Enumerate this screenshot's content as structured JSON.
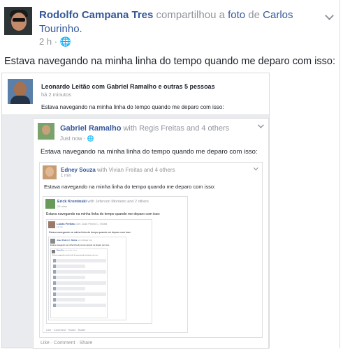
{
  "post": {
    "author": "Rodolfo Campana Tres",
    "action": "compartilhou a",
    "object": "foto",
    "preposition": "de",
    "owner": "Carlos Tourinho.",
    "time": "2 h",
    "text": "Estava navegando na minha linha do tempo quando me deparo com isso:"
  },
  "shot": {
    "level1": {
      "title": "Leonardo Leitão com Gabriel Ramalho e outras 5 pessoas",
      "time": "há 2 minutos",
      "text": "Estava navegando na minha linha do tempo quando me deparo com isso:"
    },
    "level2": {
      "name": "Gabriel Ramalho",
      "with": "with Regis Freitas and 4 others",
      "time": "Just now",
      "text": "Estava navegando na minha linha do tempo quando me deparo com isso:",
      "actions": "Like · Comment · Share"
    },
    "level3": {
      "name": "Edney Souza",
      "with": "with Vivian Freitas and 4 others",
      "time": "1 min",
      "text": "Estava navegando na minha linha do tempo quando me deparo com isso:"
    },
    "level4": {
      "name": "Erick Krominski",
      "with": "with Jeferson Monteiro and 2 others",
      "time": "26 mins",
      "text": "Estava navegando na minha linha do tempo quando me deparo com isso:",
      "actions": "Like · Comment · Share · Buffer"
    },
    "level5": {
      "name": "Lucas Freitas",
      "with": "com Joao Pedro C. Motta",
      "time": "14 min",
      "text": "Estava navegando na minha linha do tempo quando me deparo com isso:"
    },
    "level6": {
      "name": "Joao Pedro C. Motta",
      "with": "com Rafael Foz",
      "text": "Estava navegando na minha linha do tempo quando me deparo com isso:"
    },
    "level7": {
      "name": "Rafael Foz",
      "with": "com Felipe Freitas",
      "text": "Estava navegando na minha linha do tempo quando me deparo com isso:"
    }
  }
}
